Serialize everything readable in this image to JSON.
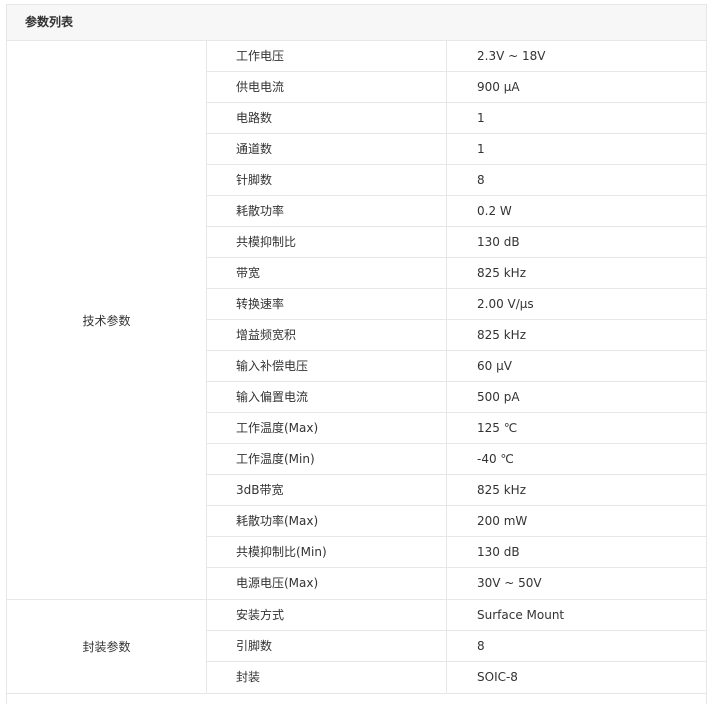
{
  "panel": {
    "title": "参数列表"
  },
  "groups": [
    {
      "label": "技术参数",
      "rows": [
        {
          "name": "工作电压",
          "value": "2.3V ~ 18V"
        },
        {
          "name": "供电电流",
          "value": "900 µA"
        },
        {
          "name": "电路数",
          "value": "1"
        },
        {
          "name": "通道数",
          "value": "1"
        },
        {
          "name": "针脚数",
          "value": "8"
        },
        {
          "name": "耗散功率",
          "value": "0.2 W"
        },
        {
          "name": "共模抑制比",
          "value": "130 dB"
        },
        {
          "name": "带宽",
          "value": "825 kHz"
        },
        {
          "name": "转换速率",
          "value": "2.00 V/µs"
        },
        {
          "name": "增益频宽积",
          "value": "825 kHz"
        },
        {
          "name": "输入补偿电压",
          "value": "60 µV"
        },
        {
          "name": "输入偏置电流",
          "value": "500 pA"
        },
        {
          "name": "工作温度(Max)",
          "value": "125 ℃"
        },
        {
          "name": "工作温度(Min)",
          "value": "-40 ℃"
        },
        {
          "name": "3dB带宽",
          "value": "825 kHz"
        },
        {
          "name": "耗散功率(Max)",
          "value": "200 mW"
        },
        {
          "name": "共模抑制比(Min)",
          "value": "130 dB"
        },
        {
          "name": "电源电压(Max)",
          "value": "30V ~ 50V"
        }
      ]
    },
    {
      "label": "封装参数",
      "rows": [
        {
          "name": "安装方式",
          "value": "Surface Mount"
        },
        {
          "name": "引脚数",
          "value": "8"
        },
        {
          "name": "封装",
          "value": "SOIC-8"
        }
      ]
    }
  ]
}
